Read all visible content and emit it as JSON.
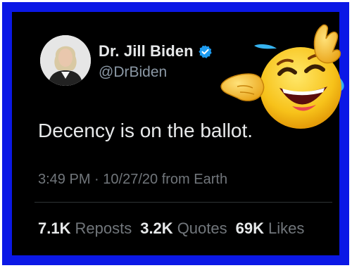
{
  "tweet": {
    "display_name": "Dr. Jill Biden",
    "handle": "@DrBiden",
    "text": "Decency is on the ballot.",
    "time": "3:49 PM",
    "separator": "·",
    "date": "10/27/20",
    "source": "from Earth",
    "stats": [
      {
        "value": "7.1K",
        "label": "Reposts"
      },
      {
        "value": "3.2K",
        "label": "Quotes"
      },
      {
        "value": "69K",
        "label": "Likes"
      }
    ]
  },
  "colors": {
    "frame_border": "#0b18e6",
    "background": "#000000",
    "verified_blue": "#1d9bf0",
    "secondary_text": "#71767b"
  },
  "icons": {
    "verified": "verified-badge-icon",
    "emoji": "laughing-crying-emoji"
  }
}
